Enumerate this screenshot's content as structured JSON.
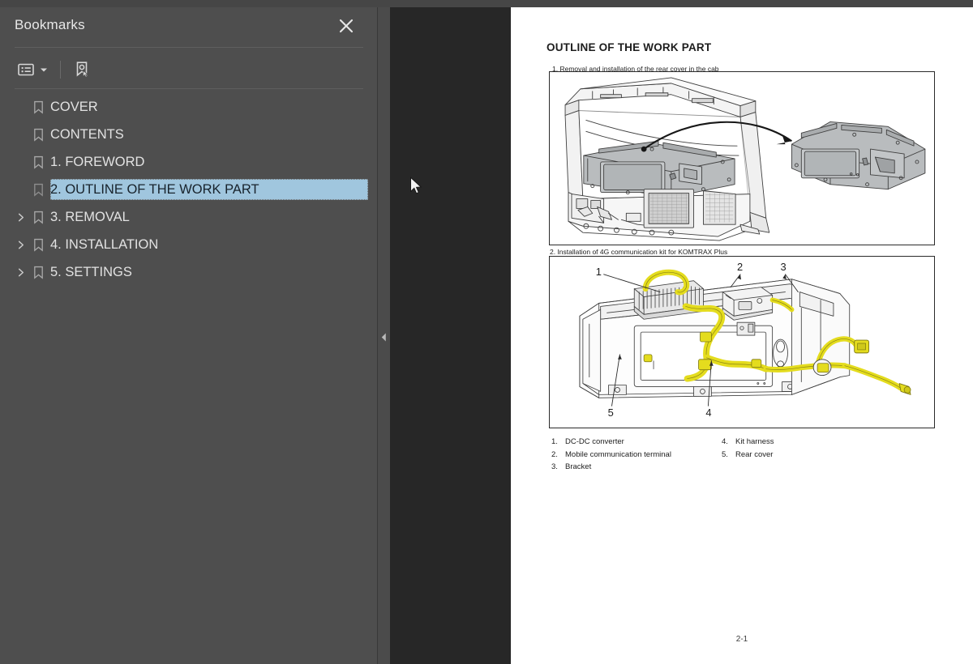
{
  "sidebar": {
    "title": "Bookmarks",
    "close_icon": "close-icon",
    "toolbar": {
      "list_options_icon": "bookmark-options-icon",
      "caret_icon": "chevron-down-icon",
      "find_icon": "find-current-bookmark-icon"
    },
    "items": [
      {
        "label": "COVER",
        "expandable": false,
        "selected": false
      },
      {
        "label": "CONTENTS",
        "expandable": false,
        "selected": false
      },
      {
        "label": "1. FOREWORD",
        "expandable": false,
        "selected": false
      },
      {
        "label": "2. OUTLINE OF THE WORK PART",
        "expandable": false,
        "selected": true
      },
      {
        "label": "3. REMOVAL",
        "expandable": true,
        "selected": false
      },
      {
        "label": "4. INSTALLATION",
        "expandable": true,
        "selected": false
      },
      {
        "label": "5. SETTINGS",
        "expandable": true,
        "selected": false
      }
    ]
  },
  "splitter": {
    "collapse_icon": "collapse-panel-left-icon"
  },
  "cursor": {
    "icon": "mouse-pointer-icon"
  },
  "document": {
    "title": "OUTLINE OF THE WORK PART",
    "figure1_caption": "1. Removal and installation of the rear cover in the cab",
    "figure2_caption": "2. Installation of 4G communication kit for KOMTRAX Plus",
    "figure2_callouts": [
      "1",
      "2",
      "3",
      "4",
      "5"
    ],
    "legend_left": [
      {
        "n": "1.",
        "text": "DC-DC converter"
      },
      {
        "n": "2.",
        "text": "Mobile communication terminal"
      },
      {
        "n": "3.",
        "text": "Bracket"
      }
    ],
    "legend_right": [
      {
        "n": "4.",
        "text": "Kit harness"
      },
      {
        "n": "5.",
        "text": "Rear cover"
      }
    ],
    "page_number": "2-1"
  },
  "colors": {
    "sidebar_bg": "#4e4e4e",
    "viewer_bg": "#272727",
    "selection": "#a0c6de",
    "harness_yellow": "#e8e020",
    "line_art": "#3c3c3c"
  }
}
